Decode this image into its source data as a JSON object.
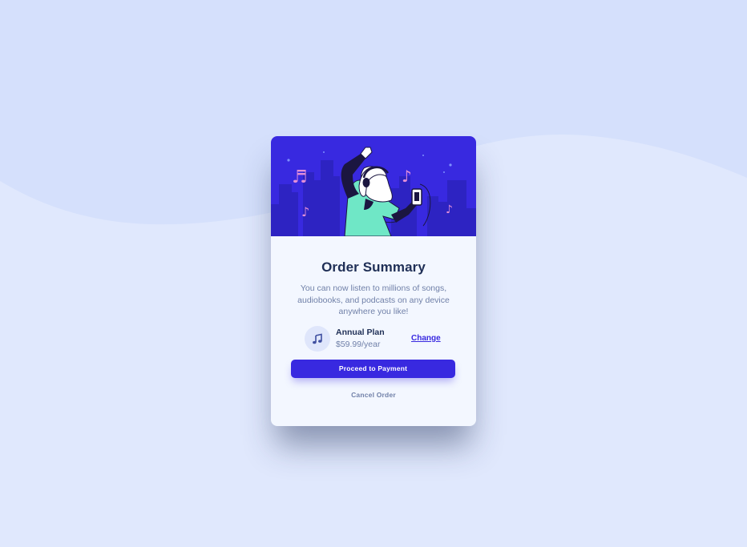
{
  "order": {
    "title": "Order Summary",
    "description": "You can now listen to millions of songs, audiobooks, and podcasts on any device anywhere you like!",
    "plan": {
      "icon": "music-note-icon",
      "name": "Annual Plan",
      "price": "$59.99/year",
      "change_label": "Change"
    },
    "actions": {
      "proceed_label": "Proceed to Payment",
      "cancel_label": "Cancel Order"
    }
  },
  "colors": {
    "page_background": "#e0e8fd",
    "wave": "#d5e0fc",
    "hero_background": "#3829e0",
    "card_background": "#f3f7ff",
    "primary": "#3829e0",
    "dark_text": "#1f2f56",
    "muted_text": "#7080a8"
  }
}
